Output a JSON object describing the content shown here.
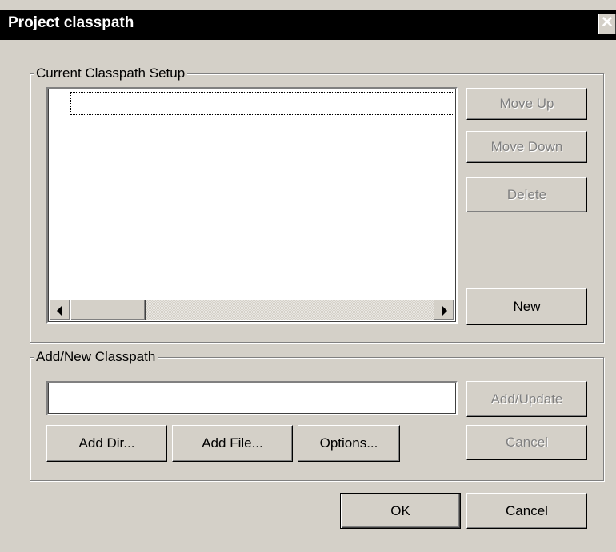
{
  "window": {
    "title": "Project classpath",
    "close_symbol": "✕"
  },
  "current_group": {
    "label": "Current Classpath Setup",
    "list_items": [],
    "buttons": {
      "move_up": "Move Up",
      "move_down": "Move Down",
      "delete": "Delete",
      "new": "New"
    }
  },
  "add_group": {
    "label": "Add/New Classpath",
    "path_value": "",
    "buttons": {
      "add_update": "Add/Update",
      "cancel": "Cancel",
      "add_dir": "Add Dir...",
      "add_file": "Add File...",
      "options": "Options..."
    }
  },
  "footer": {
    "ok": "OK",
    "cancel": "Cancel"
  }
}
